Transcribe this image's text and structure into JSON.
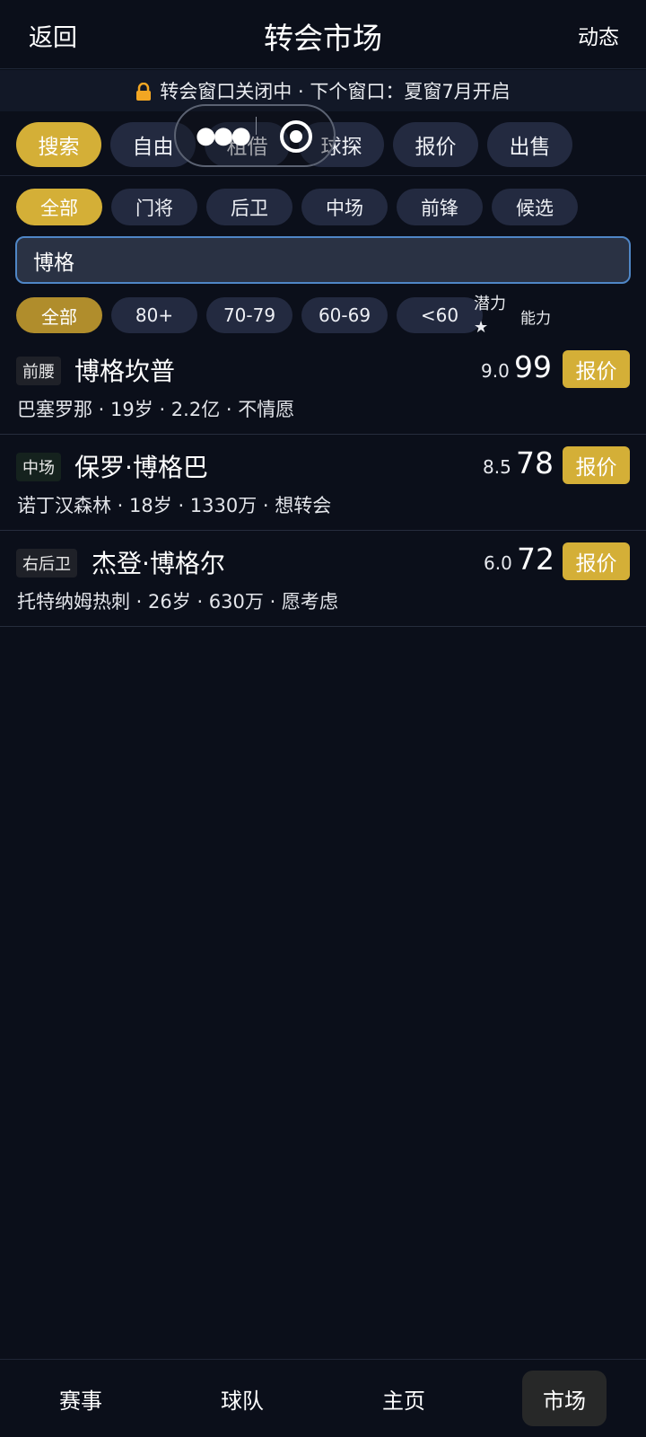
{
  "header": {
    "back": "返回",
    "title": "转会市场",
    "feed": "动态"
  },
  "notice": {
    "icon": "lock-icon",
    "text": "转会窗口关闭中 · 下个窗口：夏窗7月开启"
  },
  "tabs": [
    {
      "label": "搜索",
      "active": true
    },
    {
      "label": "自由",
      "active": false
    },
    {
      "label": "租借",
      "active": false
    },
    {
      "label": "球探",
      "active": false
    },
    {
      "label": "报价",
      "active": false
    },
    {
      "label": "出售",
      "active": false
    }
  ],
  "positions": [
    "全部",
    "门将",
    "后卫",
    "中场",
    "前锋",
    "候选"
  ],
  "search": {
    "value": "博格"
  },
  "rating_filters": [
    "全部",
    "80+",
    "70-79",
    "60-69",
    "<60"
  ],
  "sort": {
    "potential": "潜力★",
    "ability": "能力"
  },
  "players": [
    {
      "position": "前腰",
      "name": "博格坎普",
      "club": "巴塞罗那",
      "age": "19岁",
      "value": "2.2亿",
      "willingness": "不情愿",
      "potential": "9.0",
      "ability": "99",
      "action": "报价"
    },
    {
      "position": "中场",
      "name": "保罗·博格巴",
      "club": "诺丁汉森林",
      "age": "18岁",
      "value": "1330万",
      "willingness": "想转会",
      "potential": "8.5",
      "ability": "78",
      "action": "报价"
    },
    {
      "position": "右后卫",
      "name": "杰登·博格尔",
      "club": "托特纳姆热刺",
      "age": "26岁",
      "value": "630万",
      "willingness": "愿考虑",
      "potential": "6.0",
      "ability": "72",
      "action": "报价"
    }
  ],
  "nav": [
    "赛事",
    "球队",
    "主页",
    "市场"
  ],
  "colors": {
    "accent": "#d4af37",
    "background": "#0b0f1a",
    "chip": "#232a40",
    "search_border": "#4f86c6"
  }
}
